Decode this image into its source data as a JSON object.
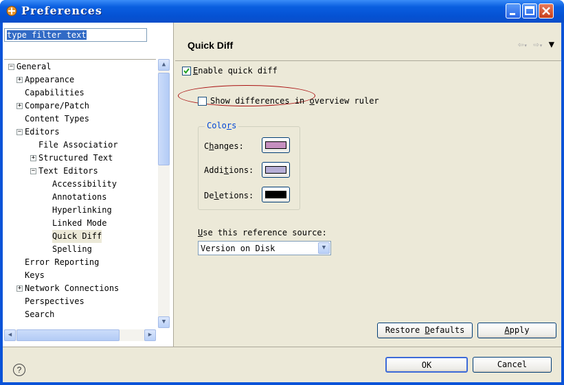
{
  "window": {
    "title": "Preferences"
  },
  "filter": {
    "value": "type filter text"
  },
  "tree": [
    {
      "label": "General",
      "expander": "−"
    },
    {
      "label": "Appearance",
      "expander": "+"
    },
    {
      "label": "Capabilities",
      "expander": ""
    },
    {
      "label": "Compare/Patch",
      "expander": "+"
    },
    {
      "label": "Content Types",
      "expander": ""
    },
    {
      "label": "Editors",
      "expander": "−"
    },
    {
      "label": "File Associatior",
      "expander": ""
    },
    {
      "label": "Structured Text",
      "expander": "+"
    },
    {
      "label": "Text Editors",
      "expander": "−"
    },
    {
      "label": "Accessibility",
      "expander": ""
    },
    {
      "label": "Annotations",
      "expander": ""
    },
    {
      "label": "Hyperlinking",
      "expander": ""
    },
    {
      "label": "Linked Mode",
      "expander": ""
    },
    {
      "label": "Quick Diff",
      "expander": ""
    },
    {
      "label": "Spelling",
      "expander": ""
    },
    {
      "label": "Error Reporting",
      "expander": ""
    },
    {
      "label": "Keys",
      "expander": ""
    },
    {
      "label": "Network Connections",
      "expander": "+"
    },
    {
      "label": "Perspectives",
      "expander": ""
    },
    {
      "label": "Search",
      "expander": ""
    }
  ],
  "page": {
    "title": "Quick Diff",
    "enable_quick_diff": {
      "pre": "",
      "mnemonic": "E",
      "post": "nable quick diff",
      "checked": true
    },
    "show_differences": {
      "pre": "Show differences in ",
      "mnemonic": "o",
      "post": "verview ruler",
      "checked": false
    },
    "colors_group": {
      "pre": "Colo",
      "mnemonic": "r",
      "post": "s"
    },
    "changes": {
      "pre": "C",
      "mnemonic": "h",
      "post": "anges:",
      "color": "#c58fbf"
    },
    "additions": {
      "pre": "Addi",
      "mnemonic": "t",
      "post": "ions:",
      "color": "#b6aed6"
    },
    "deletions": {
      "pre": "De",
      "mnemonic": "l",
      "post": "etions:",
      "color": "#000000"
    },
    "reference_label": {
      "pre": "",
      "mnemonic": "U",
      "post": "se this reference source:"
    },
    "reference_value": "Version on Disk",
    "restore_defaults": {
      "pre": "Restore ",
      "mnemonic": "D",
      "post": "efaults"
    },
    "apply": {
      "pre": "",
      "mnemonic": "A",
      "post": "pply"
    }
  },
  "footer": {
    "help": "?",
    "ok": "OK",
    "cancel": "Cancel"
  },
  "colors": {
    "title_bar": "#0552d4",
    "dialog_bg": "#ece9d8",
    "annotation_oval": "#aa1111"
  }
}
